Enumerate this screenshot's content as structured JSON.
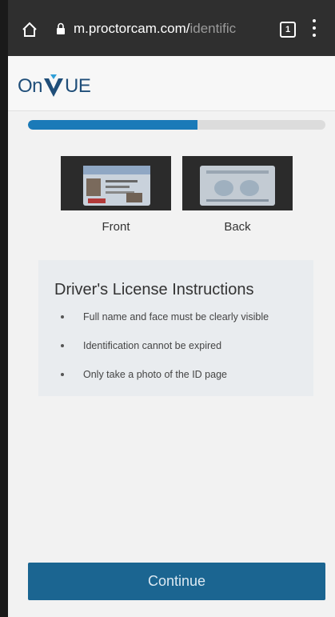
{
  "browser": {
    "url_host": "m.proctorcam.com/",
    "url_path": "identific",
    "tabs_count": "1"
  },
  "header": {
    "logo_text_left": "On",
    "logo_text_right": "UE"
  },
  "progress": {
    "fraction": 0.57
  },
  "id_images": {
    "front_label": "Front",
    "back_label": "Back"
  },
  "instructions": {
    "title": "Driver's License Instructions",
    "items": [
      "Full name and face must be clearly visible",
      "Identification cannot be expired",
      "Only take a photo of the ID page"
    ]
  },
  "continue_label": "Continue",
  "colors": {
    "accent": "#1a7ab8",
    "button": "#1b6591",
    "logo": "#1f4e79"
  }
}
